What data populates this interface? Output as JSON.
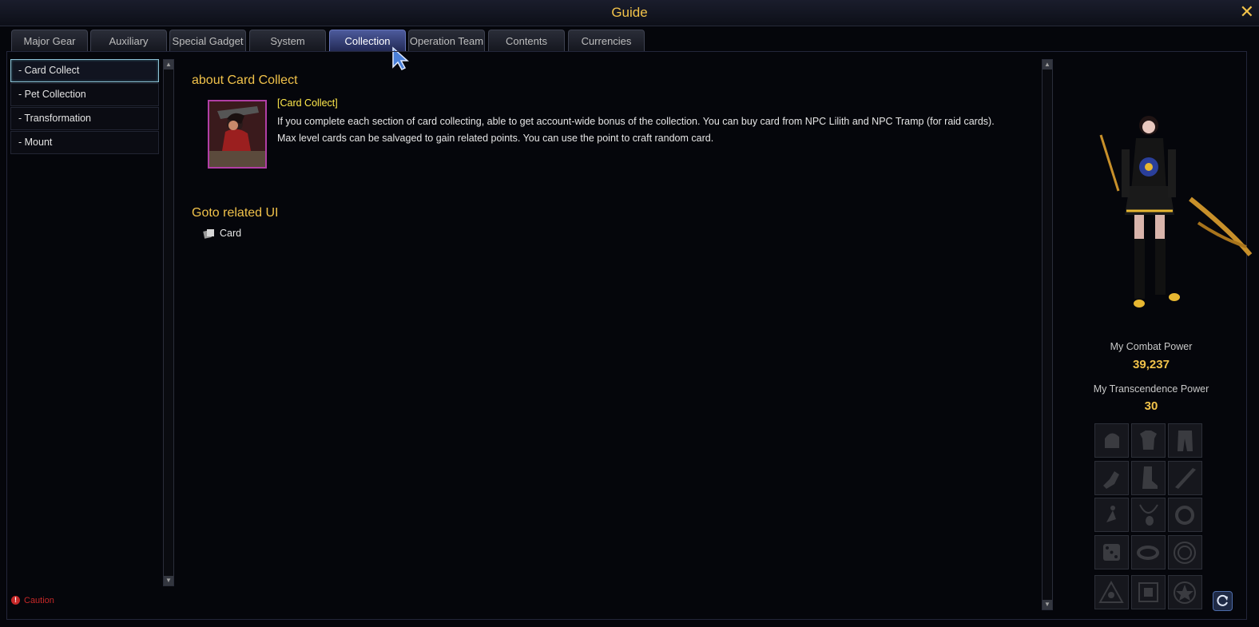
{
  "window": {
    "title": "Guide",
    "close_glyph": "✕"
  },
  "tabs": [
    {
      "label": "Major Gear"
    },
    {
      "label": "Auxiliary"
    },
    {
      "label": "Special Gadget"
    },
    {
      "label": "System"
    },
    {
      "label": "Collection",
      "active": true
    },
    {
      "label": "Operation Team"
    },
    {
      "label": "Contents"
    },
    {
      "label": "Currencies"
    }
  ],
  "sidebar": {
    "items": [
      {
        "label": "- Card Collect",
        "active": true
      },
      {
        "label": "- Pet Collection"
      },
      {
        "label": "- Transformation"
      },
      {
        "label": "- Mount"
      }
    ]
  },
  "caution": {
    "label": "Caution"
  },
  "content": {
    "heading": "about Card Collect",
    "card_tag": "[Card Collect]",
    "description": "If you complete each section of card collecting, able to get account-wide bonus of the collection. You can buy card from NPC Lilith and NPC Tramp (for raid cards). Max level cards can be salvaged to gain related points. You can use the point to craft random card.",
    "goto_heading": "Goto related UI",
    "related_items": [
      {
        "label": "Card",
        "icon": "card-icon"
      }
    ]
  },
  "character_panel": {
    "combat_power_label": "My Combat Power",
    "combat_power_value": "39,237",
    "transcendence_label": "My Transcendence Power",
    "transcendence_value": "30",
    "equipment_slots": [
      "helmet-slot-icon",
      "armor-slot-icon",
      "pants-slot-icon",
      "gloves-slot-icon",
      "boots-slot-icon",
      "weapon-slot-icon",
      "earring-slot-icon",
      "necklace-slot-icon",
      "ring-slot-icon",
      "dice-slot-icon",
      "bracelet-slot-icon",
      "orb-slot-icon",
      "triangle-emblem-slot-icon",
      "square-emblem-slot-icon",
      "star-emblem-slot-icon"
    ]
  },
  "colors": {
    "accent_gold": "#f1c24a",
    "highlight_yellow": "#ffe94c",
    "active_tab": "#4c5a9c",
    "caution_red": "#c62828"
  }
}
